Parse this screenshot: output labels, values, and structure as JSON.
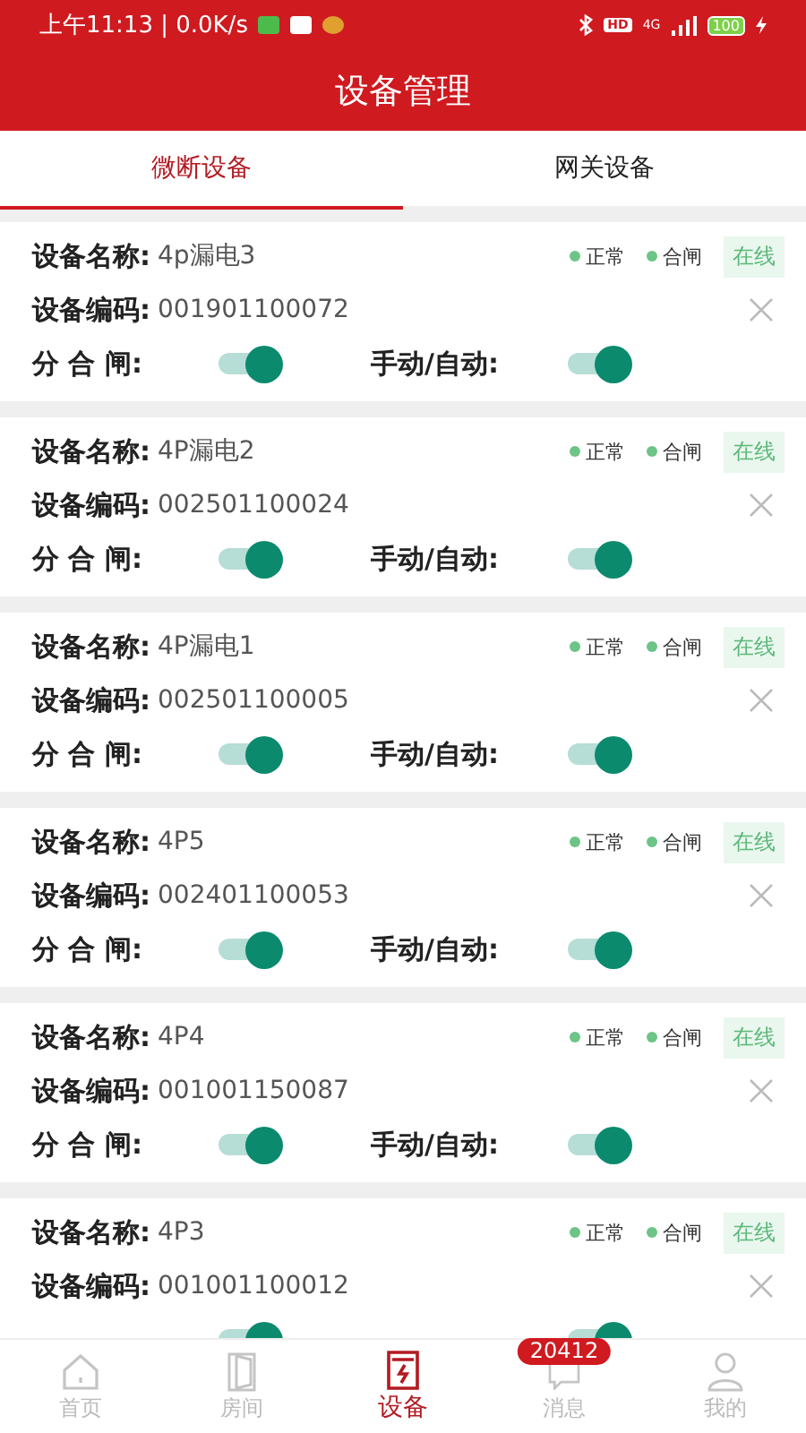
{
  "status_bar": {
    "time": "上午11:13 | 0.0K/s",
    "hd": "HD",
    "network": "4G",
    "battery": "100"
  },
  "header": {
    "title": "设备管理"
  },
  "tabs": [
    {
      "label": "微断设备",
      "selected": true
    },
    {
      "label": "网关设备",
      "selected": false
    }
  ],
  "devices": [
    {
      "name_label": "设备名称:",
      "name": "4p漏电3",
      "code_label": "设备编码:",
      "code": "001901100072",
      "status": "正常",
      "switch_state": "合闸",
      "online": "在线",
      "breaker_label": "分 合 闸:",
      "breaker_on": true,
      "mode_label": "手动/自动:",
      "mode_on": true
    },
    {
      "name_label": "设备名称:",
      "name": "4P漏电2",
      "code_label": "设备编码:",
      "code": "002501100024",
      "status": "正常",
      "switch_state": "合闸",
      "online": "在线",
      "breaker_label": "分 合 闸:",
      "breaker_on": true,
      "mode_label": "手动/自动:",
      "mode_on": true
    },
    {
      "name_label": "设备名称:",
      "name": "4P漏电1",
      "code_label": "设备编码:",
      "code": "002501100005",
      "status": "正常",
      "switch_state": "合闸",
      "online": "在线",
      "breaker_label": "分 合 闸:",
      "breaker_on": true,
      "mode_label": "手动/自动:",
      "mode_on": true
    },
    {
      "name_label": "设备名称:",
      "name": "4P5",
      "code_label": "设备编码:",
      "code": "002401100053",
      "status": "正常",
      "switch_state": "合闸",
      "online": "在线",
      "breaker_label": "分 合 闸:",
      "breaker_on": true,
      "mode_label": "手动/自动:",
      "mode_on": true
    },
    {
      "name_label": "设备名称:",
      "name": "4P4",
      "code_label": "设备编码:",
      "code": "001001150087",
      "status": "正常",
      "switch_state": "合闸",
      "online": "在线",
      "breaker_label": "分 合 闸:",
      "breaker_on": true,
      "mode_label": "手动/自动:",
      "mode_on": true
    },
    {
      "name_label": "设备名称:",
      "name": "4P3",
      "code_label": "设备编码:",
      "code": "001001100012",
      "status": "正常",
      "switch_state": "合闸",
      "online": "在线",
      "breaker_on": true,
      "mode_on": true
    }
  ],
  "bottom_nav": [
    {
      "kind": "home",
      "label": "首页",
      "selected": false
    },
    {
      "kind": "room",
      "label": "房间",
      "selected": false
    },
    {
      "kind": "device",
      "label": "设备",
      "selected": true
    },
    {
      "kind": "message",
      "label": "消息",
      "selected": false,
      "badge": "20412"
    },
    {
      "kind": "profile",
      "label": "我的",
      "selected": false
    }
  ]
}
